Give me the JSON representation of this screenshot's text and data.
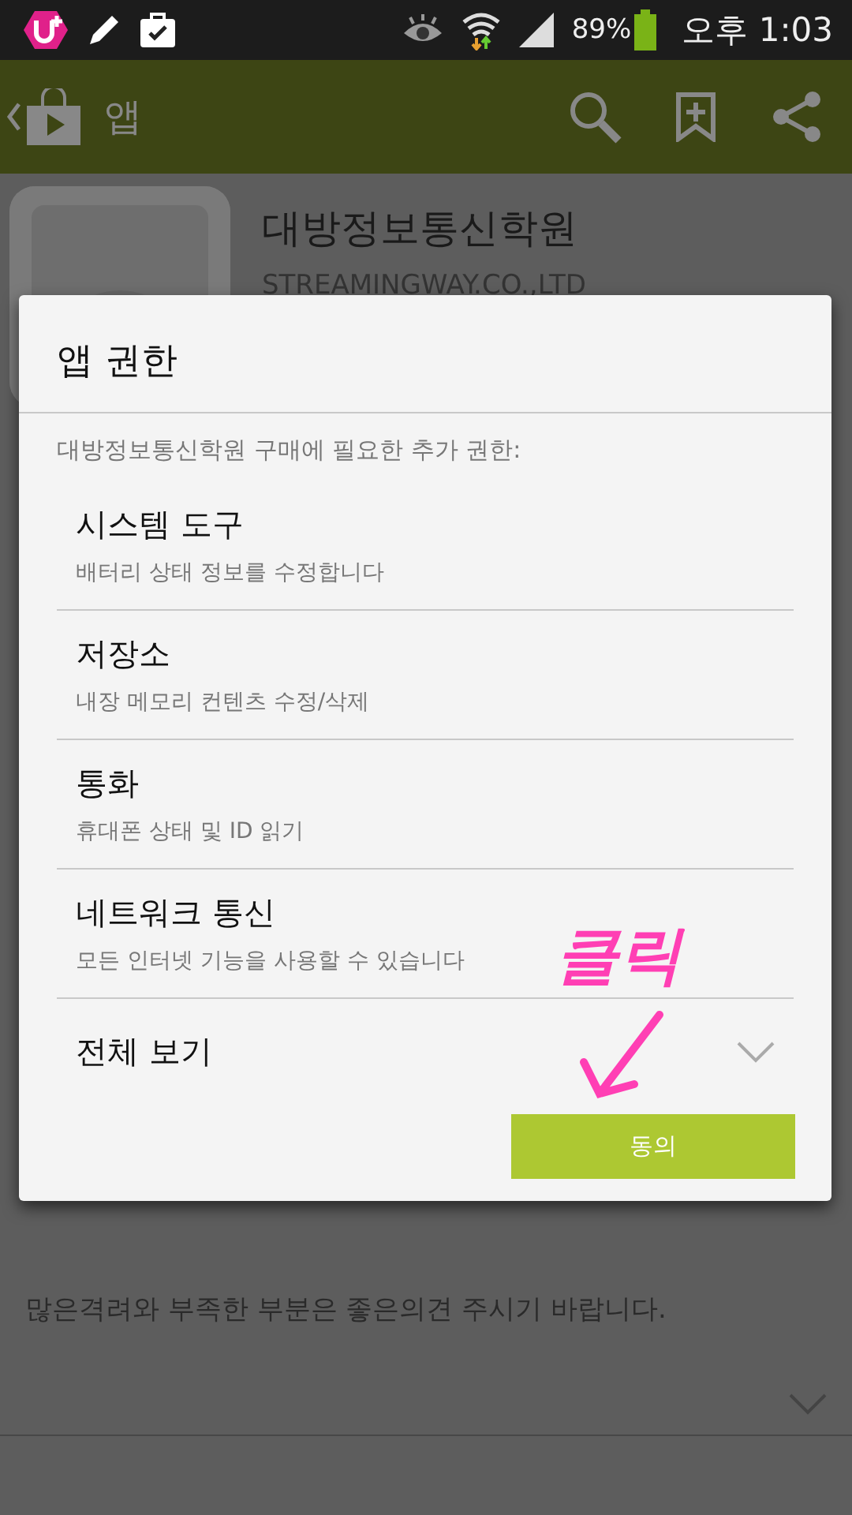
{
  "status_bar": {
    "battery": "89%",
    "time": "오후 1:03"
  },
  "app_bar": {
    "title": "앱"
  },
  "app_header": {
    "name": "대방정보통신학원",
    "developer": "STREAMINGWAY.CO.,LTD"
  },
  "review_text": "많은격려와 부족한 부분은 좋은의견 주시기 바랍니다.",
  "dialog": {
    "title": "앱 권한",
    "subtitle": "대방정보통신학원 구매에 필요한 추가 권한:",
    "permissions": [
      {
        "title": "시스템 도구",
        "description": "배터리 상태 정보를 수정합니다"
      },
      {
        "title": "저장소",
        "description": "내장 메모리 컨텐츠 수정/삭제"
      },
      {
        "title": "통화",
        "description": "휴대폰 상태 및 ID 읽기"
      },
      {
        "title": "네트워크 통신",
        "description": "모든 인터넷 기능을 사용할 수 있습니다"
      }
    ],
    "see_all": "전체 보기",
    "accept_button": "동의"
  },
  "annotation": {
    "text": "클릭"
  }
}
